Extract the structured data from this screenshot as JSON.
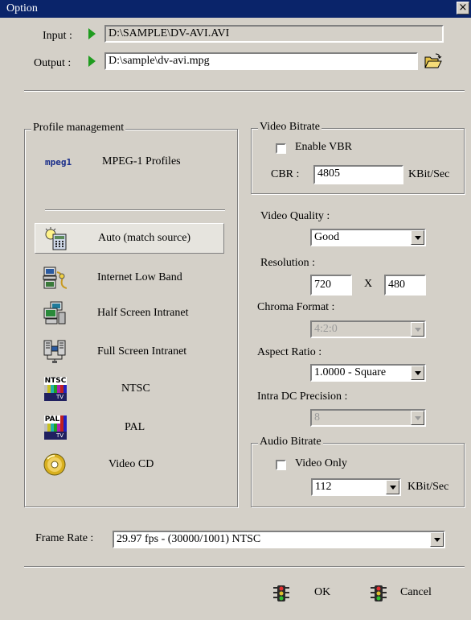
{
  "window": {
    "title": "Option",
    "close_label": "×"
  },
  "io": {
    "input_label": "Input :",
    "input_value": "D:\\SAMPLE\\DV-AVI.AVI",
    "output_label": "Output :",
    "output_value": "D:\\sample\\dv-avi.mpg"
  },
  "profile_mgmt": {
    "title": "Profile management",
    "mpeg_logo": "mpeg1",
    "mpeg_label": "MPEG-1 Profiles",
    "items": [
      {
        "label": "Auto (match source)",
        "icon": "auto-match-icon",
        "selected": true
      },
      {
        "label": "Internet Low Band",
        "icon": "internet-computer-icon"
      },
      {
        "label": "Half Screen Intranet",
        "icon": "network-computers-icon"
      },
      {
        "label": "Full Screen Intranet",
        "icon": "network-servers-icon"
      },
      {
        "label": "NTSC",
        "icon": "ntsc-tv-icon"
      },
      {
        "label": "PAL",
        "icon": "pal-tv-icon"
      },
      {
        "label": "Video CD",
        "icon": "cd-disc-icon"
      }
    ],
    "ntsc_badge": "NTSC",
    "pal_badge": "PAL",
    "tv_badge": "TV"
  },
  "video_bitrate": {
    "title": "Video Bitrate",
    "enable_vbr_label": "Enable VBR",
    "enable_vbr_checked": false,
    "cbr_label": "CBR :",
    "cbr_value": "4805",
    "cbr_unit": "KBit/Sec"
  },
  "video_quality": {
    "label": "Video Quality :",
    "value": "Good"
  },
  "resolution": {
    "label": "Resolution :",
    "width": "720",
    "sep": "X",
    "height": "480"
  },
  "chroma": {
    "label": "Chroma Format :",
    "value": "4:2:0"
  },
  "aspect": {
    "label": "Aspect Ratio :",
    "value": "1.0000 - Square"
  },
  "intra_dc": {
    "label": "Intra DC Precision :",
    "value": "8"
  },
  "audio_bitrate": {
    "title": "Audio Bitrate",
    "video_only_label": "Video Only",
    "video_only_checked": false,
    "value": "112",
    "unit": "KBit/Sec"
  },
  "frame_rate": {
    "label": "Frame Rate :",
    "value": "29.97 fps - (30000/1001) NTSC"
  },
  "buttons": {
    "ok": "OK",
    "cancel": "Cancel"
  },
  "colors": {
    "title_bar": "#0a246a",
    "dialog_bg": "#d4d0c8",
    "arrow": "#1f9c1f"
  }
}
